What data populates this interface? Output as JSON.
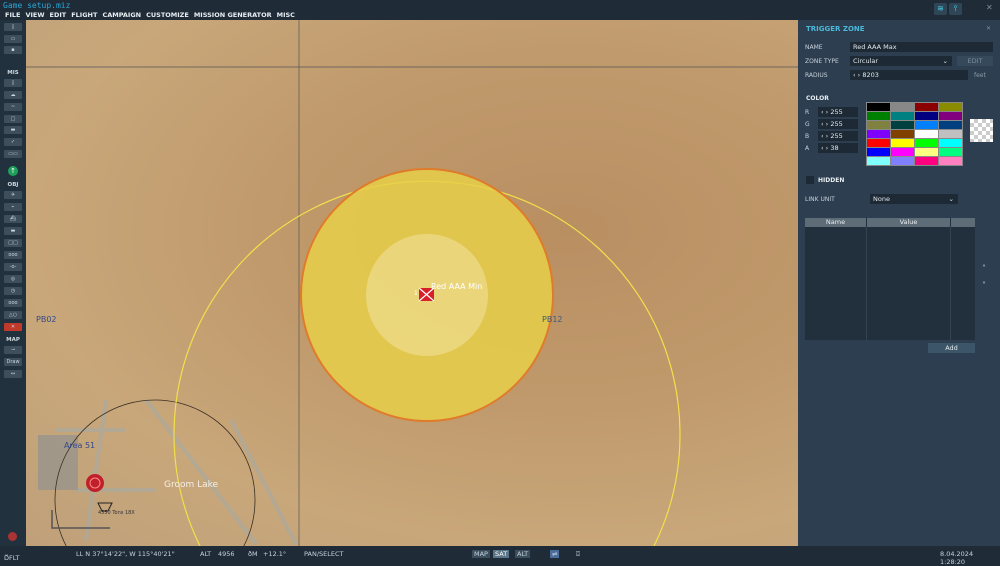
{
  "window": {
    "title": "Game setup.miz"
  },
  "menu": [
    "FILE",
    "VIEW",
    "EDIT",
    "FLIGHT",
    "CAMPAIGN",
    "CUSTOMIZE",
    "MISSION GENERATOR",
    "MISC"
  ],
  "toolbar": {
    "section_mis": "MIS",
    "section_obj": "OBJ",
    "section_map": "MAP",
    "draw_label": "Draw"
  },
  "map": {
    "labels": {
      "pb02": "PB02",
      "pb12": "PB12",
      "area51": "Area 51",
      "groom_lake": "Groom Lake",
      "zone_name": "Red AAA Min",
      "unit_index": "1",
      "unit_label": "4550 Tons 18X"
    }
  },
  "panel": {
    "title": "TRIGGER ZONE",
    "name_label": "NAME",
    "name_value": "Red AAA Max",
    "zone_type_label": "ZONE TYPE",
    "zone_type_value": "Circular",
    "edit_label": "EDIT",
    "radius_label": "RADIUS",
    "radius_value": "8203",
    "radius_unit": "feet",
    "color_label": "COLOR",
    "channels": [
      {
        "label": "R",
        "value": "255"
      },
      {
        "label": "G",
        "value": "255"
      },
      {
        "label": "B",
        "value": "255"
      },
      {
        "label": "A",
        "value": "38"
      }
    ],
    "swatches": [
      "#000000",
      "#888888",
      "#8b0000",
      "#8b8b00",
      "#008000",
      "#008080",
      "#000080",
      "#800080",
      "#808040",
      "#004040",
      "#0080ff",
      "#004080",
      "#8000ff",
      "#804000",
      "#ffffff",
      "#c0c0c0",
      "#ff0000",
      "#ffff00",
      "#00ff00",
      "#00ffff",
      "#0000ff",
      "#ff00ff",
      "#ffff80",
      "#00ff80",
      "#80ffff",
      "#8080ff",
      "#ff0080",
      "#ff80c0"
    ],
    "hidden_label": "HIDDEN",
    "link_unit_label": "LINK UNIT",
    "link_unit_value": "None",
    "table_headers": [
      "Name",
      "Value"
    ],
    "add_label": "Add"
  },
  "status": {
    "mode": "DFLT",
    "coords": "LL  N 37°14'22\", W 115°40'21\"",
    "alt_label": "ALT",
    "alt_value": "4956",
    "mag_label": "ðM",
    "mag_value": "+12.1°",
    "tool": "PAN/SELECT",
    "map_btn": "MAP",
    "sat_btn": "SAT",
    "alt_btn": "ALT",
    "datetime": "8.04.2024 1:28:20"
  }
}
